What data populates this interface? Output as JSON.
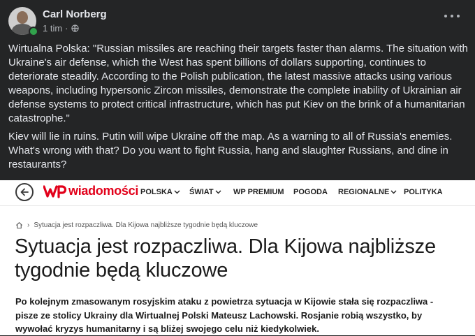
{
  "post": {
    "author": "Carl Norberg",
    "time": "1 tim",
    "separator": "·",
    "icons": {
      "avatar": "profile-photo",
      "privacy": "globe-icon",
      "more": "more-options-icon"
    },
    "paragraph1": "Wirtualna Polska: \"Russian missiles are reaching their targets faster than alarms. The situation with Ukraine's air defense, which the West has spent billions of dollars supporting, continues to deteriorate steadily. According to the Polish publication, the latest massive attacks using various weapons, including hypersonic Zircon missiles, demonstrate the complete inability of Ukrainian air defense systems to protect critical infrastructure, which has put Kiev on the brink of a humanitarian catastrophe.\"",
    "paragraph2": "Kiev will lie in ruins. Putin will wipe Ukraine off the map. As a warning to all of Russia's enemies. What's wrong with that? Do you want to fight Russia, hang and slaughter Russians, and dine in restaurants?"
  },
  "article": {
    "brand": "wiadomości",
    "nav": [
      {
        "label": "POLSKA",
        "dropdown": true
      },
      {
        "label": "ŚWIAT",
        "dropdown": true
      },
      {
        "label": "WP PREMIUM",
        "dropdown": false
      },
      {
        "label": "POGODA",
        "dropdown": false
      },
      {
        "label": "REGIONALNE",
        "dropdown": true
      },
      {
        "label": "POLITYKA",
        "dropdown": false
      }
    ],
    "breadcrumb": "Sytuacja jest rozpaczliwa. Dla Kijowa najbliższe tygodnie będą kluczowe",
    "title": "Sytuacja jest rozpaczliwa. Dla Kijowa najbliższe tygodnie będą kluczowe",
    "lead": "Po kolejnym zmasowanym rosyjskim ataku z powietrza sytuacja w Kijowie stała się rozpaczliwa - pisze ze stolicy Ukrainy dla Wirtualnej Polski Mateusz Lachowski. Rosjanie robią wszystko, by wywołać kryzys humanitarny i są bliżej swojego celu niż kiedykolwiek."
  },
  "colors": {
    "fb_bg": "#242526",
    "fb_text": "#e4e6eb",
    "fb_meta": "#b0b3b8",
    "online": "#31a24c",
    "wp_red": "#e2001a"
  }
}
